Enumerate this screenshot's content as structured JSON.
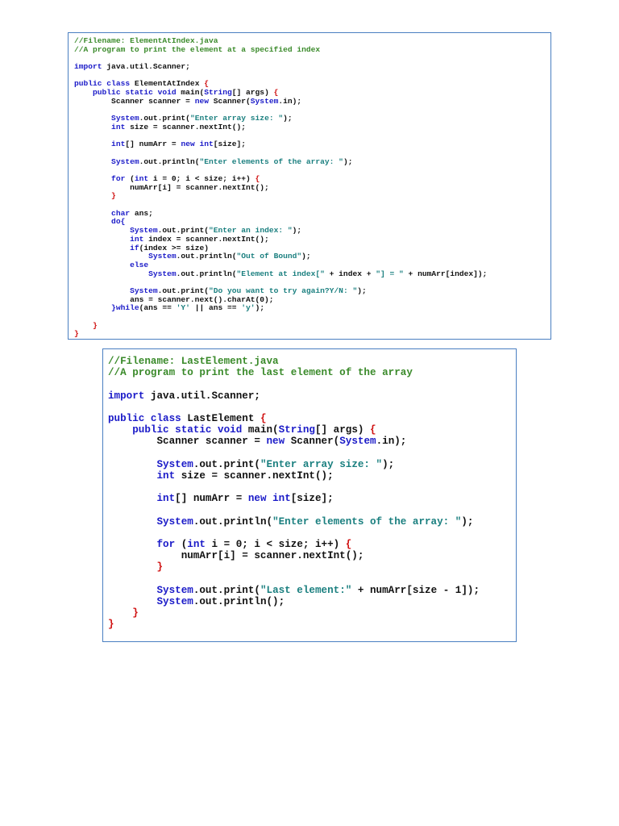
{
  "box1": {
    "lines": [
      {
        "segs": [
          {
            "t": "//Filename: ElementAtIndex.java",
            "c": "cm"
          }
        ]
      },
      {
        "segs": [
          {
            "t": "//A program to print the element at a specified index",
            "c": "cm"
          }
        ]
      },
      {
        "gap": true
      },
      {
        "segs": [
          {
            "t": "import",
            "c": "kw"
          },
          {
            "t": " java.util.Scanner;",
            "c": "id"
          }
        ]
      },
      {
        "gap": true
      },
      {
        "segs": [
          {
            "t": "public class",
            "c": "kw"
          },
          {
            "t": " ElementAtIndex ",
            "c": "id"
          },
          {
            "t": "{",
            "c": "br"
          }
        ]
      },
      {
        "segs": [
          {
            "t": "    public static void",
            "c": "kw"
          },
          {
            "t": " main(",
            "c": "id"
          },
          {
            "t": "String",
            "c": "kw"
          },
          {
            "t": "[] args) ",
            "c": "id"
          },
          {
            "t": "{",
            "c": "br"
          }
        ]
      },
      {
        "segs": [
          {
            "t": "        Scanner scanner = ",
            "c": "id"
          },
          {
            "t": "new",
            "c": "kw"
          },
          {
            "t": " Scanner(",
            "c": "id"
          },
          {
            "t": "System",
            "c": "sy"
          },
          {
            "t": ".in);",
            "c": "id"
          }
        ]
      },
      {
        "gap": true
      },
      {
        "segs": [
          {
            "t": "        System",
            "c": "sy"
          },
          {
            "t": ".out.print(",
            "c": "id"
          },
          {
            "t": "\"Enter array size: \"",
            "c": "st"
          },
          {
            "t": ");",
            "c": "id"
          }
        ]
      },
      {
        "segs": [
          {
            "t": "        int",
            "c": "kw"
          },
          {
            "t": " size = scanner.nextInt();",
            "c": "id"
          }
        ]
      },
      {
        "gap": true
      },
      {
        "segs": [
          {
            "t": "        int",
            "c": "kw"
          },
          {
            "t": "[] numArr = ",
            "c": "id"
          },
          {
            "t": "new int",
            "c": "kw"
          },
          {
            "t": "[size];",
            "c": "id"
          }
        ]
      },
      {
        "gap": true
      },
      {
        "segs": [
          {
            "t": "        System",
            "c": "sy"
          },
          {
            "t": ".out.println(",
            "c": "id"
          },
          {
            "t": "\"Enter elements of the array: \"",
            "c": "st"
          },
          {
            "t": ");",
            "c": "id"
          }
        ]
      },
      {
        "gap": true
      },
      {
        "segs": [
          {
            "t": "        for",
            "c": "kw"
          },
          {
            "t": " (",
            "c": "id"
          },
          {
            "t": "int",
            "c": "kw"
          },
          {
            "t": " i = 0; i < size; i++) ",
            "c": "id"
          },
          {
            "t": "{",
            "c": "br"
          }
        ]
      },
      {
        "segs": [
          {
            "t": "            numArr[i] = scanner.nextInt();",
            "c": "id"
          }
        ]
      },
      {
        "segs": [
          {
            "t": "        }",
            "c": "br"
          }
        ]
      },
      {
        "gap": true
      },
      {
        "segs": [
          {
            "t": "        char",
            "c": "kw"
          },
          {
            "t": " ans;",
            "c": "id"
          }
        ]
      },
      {
        "segs": [
          {
            "t": "        do{",
            "c": "kw"
          }
        ]
      },
      {
        "segs": [
          {
            "t": "            System",
            "c": "sy"
          },
          {
            "t": ".out.print(",
            "c": "id"
          },
          {
            "t": "\"Enter an index: \"",
            "c": "st"
          },
          {
            "t": ");",
            "c": "id"
          }
        ]
      },
      {
        "segs": [
          {
            "t": "            int",
            "c": "kw"
          },
          {
            "t": " index = scanner.nextInt();",
            "c": "id"
          }
        ]
      },
      {
        "segs": [
          {
            "t": "            if",
            "c": "kw"
          },
          {
            "t": "(index >= size)",
            "c": "id"
          }
        ]
      },
      {
        "segs": [
          {
            "t": "                System",
            "c": "sy"
          },
          {
            "t": ".out.println(",
            "c": "id"
          },
          {
            "t": "\"Out of Bound\"",
            "c": "st"
          },
          {
            "t": ");",
            "c": "id"
          }
        ]
      },
      {
        "segs": [
          {
            "t": "            else",
            "c": "kw"
          }
        ]
      },
      {
        "segs": [
          {
            "t": "                System",
            "c": "sy"
          },
          {
            "t": ".out.println(",
            "c": "id"
          },
          {
            "t": "\"Element at index[\"",
            "c": "st"
          },
          {
            "t": " + index + ",
            "c": "id"
          },
          {
            "t": "\"] = \"",
            "c": "st"
          },
          {
            "t": " + numArr[index]);",
            "c": "id"
          }
        ]
      },
      {
        "gap": true
      },
      {
        "segs": [
          {
            "t": "            System",
            "c": "sy"
          },
          {
            "t": ".out.print(",
            "c": "id"
          },
          {
            "t": "\"Do you want to try again?Y/N: \"",
            "c": "st"
          },
          {
            "t": ");",
            "c": "id"
          }
        ]
      },
      {
        "segs": [
          {
            "t": "            ans = scanner.next().charAt(0);",
            "c": "id"
          }
        ]
      },
      {
        "segs": [
          {
            "t": "        }while",
            "c": "kw"
          },
          {
            "t": "(ans == ",
            "c": "id"
          },
          {
            "t": "'Y'",
            "c": "st"
          },
          {
            "t": " || ans == ",
            "c": "id"
          },
          {
            "t": "'y'",
            "c": "st"
          },
          {
            "t": ");",
            "c": "id"
          }
        ]
      },
      {
        "gap": true
      },
      {
        "segs": [
          {
            "t": "    }",
            "c": "br"
          }
        ]
      },
      {
        "segs": [
          {
            "t": "}",
            "c": "br"
          }
        ]
      }
    ]
  },
  "box2": {
    "lines": [
      {
        "segs": [
          {
            "t": "//Filename: LastElement.java",
            "c": "cm"
          }
        ]
      },
      {
        "segs": [
          {
            "t": "//A program to print the last element of the array",
            "c": "cm"
          }
        ]
      },
      {
        "gap": true
      },
      {
        "segs": [
          {
            "t": "import",
            "c": "kw"
          },
          {
            "t": " java.util.Scanner;",
            "c": "id"
          }
        ]
      },
      {
        "gap": true
      },
      {
        "segs": [
          {
            "t": "public class",
            "c": "kw"
          },
          {
            "t": " LastElement ",
            "c": "id"
          },
          {
            "t": "{",
            "c": "br"
          }
        ]
      },
      {
        "segs": [
          {
            "t": "    public static void",
            "c": "kw"
          },
          {
            "t": " main(",
            "c": "id"
          },
          {
            "t": "String",
            "c": "kw"
          },
          {
            "t": "[] args) ",
            "c": "id"
          },
          {
            "t": "{",
            "c": "br"
          }
        ]
      },
      {
        "segs": [
          {
            "t": "        Scanner scanner = ",
            "c": "id"
          },
          {
            "t": "new",
            "c": "kw"
          },
          {
            "t": " Scanner(",
            "c": "id"
          },
          {
            "t": "System",
            "c": "sy"
          },
          {
            "t": ".in);",
            "c": "id"
          }
        ]
      },
      {
        "gap": true
      },
      {
        "segs": [
          {
            "t": "        System",
            "c": "sy"
          },
          {
            "t": ".out.print(",
            "c": "id"
          },
          {
            "t": "\"Enter array size: \"",
            "c": "st"
          },
          {
            "t": ");",
            "c": "id"
          }
        ]
      },
      {
        "segs": [
          {
            "t": "        int",
            "c": "kw"
          },
          {
            "t": " size = scanner.nextInt();",
            "c": "id"
          }
        ]
      },
      {
        "gap": true
      },
      {
        "segs": [
          {
            "t": "        int",
            "c": "kw"
          },
          {
            "t": "[] numArr = ",
            "c": "id"
          },
          {
            "t": "new int",
            "c": "kw"
          },
          {
            "t": "[size];",
            "c": "id"
          }
        ]
      },
      {
        "gap": true
      },
      {
        "segs": [
          {
            "t": "        System",
            "c": "sy"
          },
          {
            "t": ".out.println(",
            "c": "id"
          },
          {
            "t": "\"Enter elements of the array: \"",
            "c": "st"
          },
          {
            "t": ");",
            "c": "id"
          }
        ]
      },
      {
        "gap": true
      },
      {
        "segs": [
          {
            "t": "        for",
            "c": "kw"
          },
          {
            "t": " (",
            "c": "id"
          },
          {
            "t": "int",
            "c": "kw"
          },
          {
            "t": " i = 0; i < size; i++) ",
            "c": "id"
          },
          {
            "t": "{",
            "c": "br"
          }
        ]
      },
      {
        "segs": [
          {
            "t": "            numArr[i] = scanner.nextInt();",
            "c": "id"
          }
        ]
      },
      {
        "segs": [
          {
            "t": "        }",
            "c": "br"
          }
        ]
      },
      {
        "gap": true
      },
      {
        "segs": [
          {
            "t": "        System",
            "c": "sy"
          },
          {
            "t": ".out.print(",
            "c": "id"
          },
          {
            "t": "\"Last element:\"",
            "c": "st"
          },
          {
            "t": " + numArr[size - 1]);",
            "c": "id"
          }
        ]
      },
      {
        "segs": [
          {
            "t": "        System",
            "c": "sy"
          },
          {
            "t": ".out.println();",
            "c": "id"
          }
        ]
      },
      {
        "segs": [
          {
            "t": "    }",
            "c": "br"
          }
        ]
      },
      {
        "segs": [
          {
            "t": "}",
            "c": "br"
          }
        ]
      }
    ]
  }
}
